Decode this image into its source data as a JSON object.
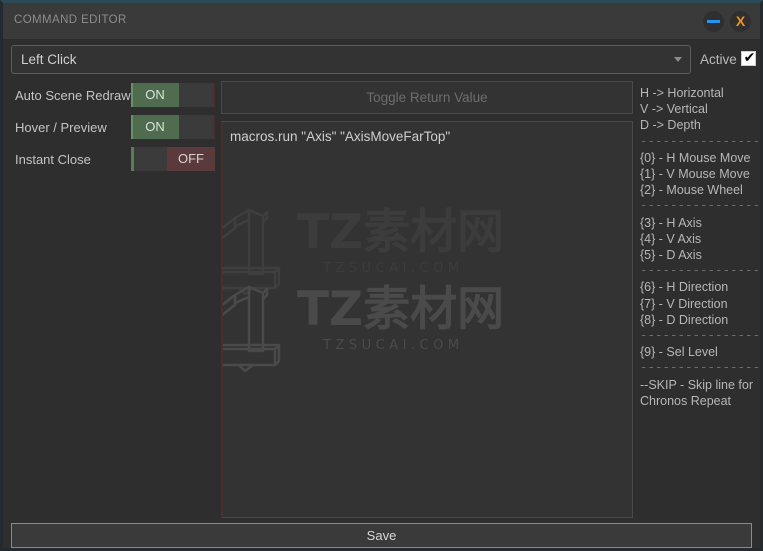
{
  "window": {
    "title": "COMMAND EDITOR",
    "minimize_icon": "minimize-icon",
    "close_icon": "close-icon",
    "close_glyph": "X",
    "accent_blue": "#2196f3",
    "accent_orange": "#f0941e",
    "background": "#2e2e2e",
    "titlebar_background": "#3a3a3a"
  },
  "command_row": {
    "selected_command": "Left Click",
    "chevron_icon": "chevron-down-icon",
    "active_label": "Active",
    "active_checked": true,
    "check_glyph": "✔"
  },
  "options": [
    {
      "label": "Auto Scene Redraw",
      "state": "ON",
      "on": true
    },
    {
      "label": "Hover / Preview",
      "state": "ON",
      "on": true
    },
    {
      "label": "Instant Close",
      "state": "OFF",
      "on": false
    }
  ],
  "return_button": {
    "label": "Toggle Return Value"
  },
  "script_editor": {
    "content": "macros.run \"Axis\" \"AxisMoveFarTop\""
  },
  "watermarks": [
    {
      "main": "TZ素材网",
      "sub": "TZSUCAI.COM"
    },
    {
      "main": "TZ素材网",
      "sub": "TZSUCAI.COM"
    }
  ],
  "legend": {
    "groups": [
      {
        "lines": [
          "H -> Horizontal",
          "V -> Vertical",
          "D -> Depth"
        ]
      },
      {
        "lines": [
          "{0} - H Mouse Move",
          "{1} - V Mouse Move",
          "{2} - Mouse Wheel"
        ]
      },
      {
        "lines": [
          "{3} - H Axis",
          "{4} - V Axis",
          "{5} - D Axis"
        ]
      },
      {
        "lines": [
          "{6} - H Direction",
          "{7} - V Direction",
          "{8} - D Direction"
        ]
      },
      {
        "lines": [
          "{9} - Sel Level"
        ]
      },
      {
        "lines": [
          "--SKIP - Skip line for Chronos Repeat"
        ]
      }
    ],
    "separator": "------------------------"
  },
  "save_button": {
    "label": "Save"
  }
}
